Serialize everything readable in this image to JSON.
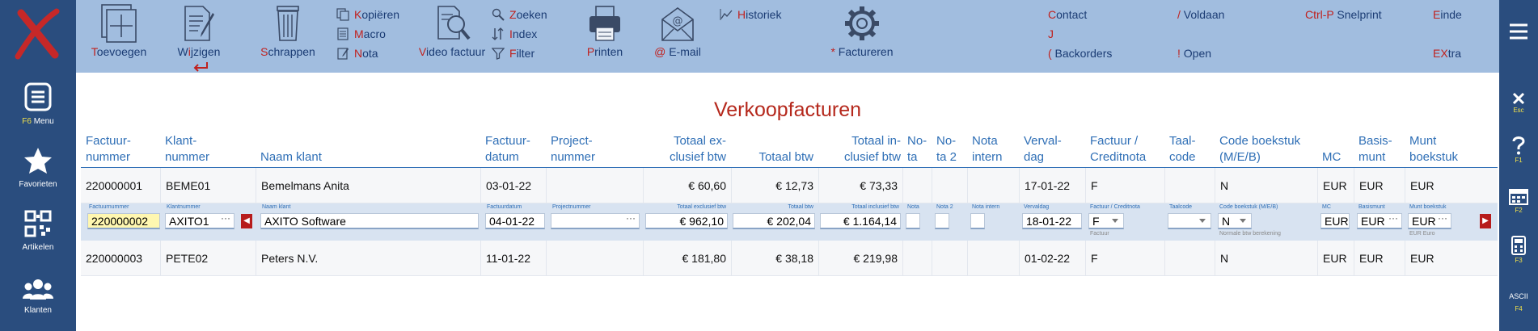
{
  "left_nav": [
    {
      "label": "Menu",
      "key": "F6"
    },
    {
      "label": "Favorieten",
      "key": ""
    },
    {
      "label": "Artikelen",
      "key": ""
    },
    {
      "label": "Klanten",
      "key": ""
    }
  ],
  "right_nav": [
    {
      "label": "",
      "key": "Esc"
    },
    {
      "label": "",
      "key": "F1"
    },
    {
      "label": "",
      "key": "F2"
    },
    {
      "label": "",
      "key": "F3"
    },
    {
      "label": "ASCII",
      "key": "F4"
    }
  ],
  "toolbar": {
    "toevoegen": {
      "hot": "T",
      "rest": "oevoegen"
    },
    "wijzigen": {
      "pre": "W",
      "hot": "i",
      "rest": "jzigen"
    },
    "schrappen": {
      "hot": "S",
      "rest": "chrappen"
    },
    "kopieren": {
      "hot": "K",
      "rest": "opiëren"
    },
    "macro": {
      "hot": "M",
      "rest": "acro"
    },
    "nota": {
      "hot": "N",
      "rest": "ota"
    },
    "video": {
      "hot": "V",
      "rest": "ideo factuur"
    },
    "zoeken": {
      "hot": "Z",
      "rest": "oeken"
    },
    "index": {
      "hot": "I",
      "rest": "ndex"
    },
    "filter": {
      "hot": "F",
      "rest": "ilter"
    },
    "printen": {
      "hot": "P",
      "rest": "rinten"
    },
    "email": {
      "hot": "@",
      "rest": " E-mail"
    },
    "historiek": {
      "hot": "H",
      "rest": "istoriek"
    },
    "factureren": {
      "hot": "*",
      "rest": " Factureren"
    },
    "contact": {
      "hot": "C",
      "rest": "ontact"
    },
    "j_label": {
      "hot": "J",
      "rest": ""
    },
    "backorders": {
      "hot": "(",
      "rest": " Backorders"
    },
    "voldaan": {
      "hot": "/",
      "rest": " Voldaan"
    },
    "open": {
      "hot": "!",
      "rest": " Open"
    },
    "snelprint": {
      "hot": "Ctrl-P",
      "rest": " Snelprint"
    },
    "einde": {
      "hot": "E",
      "rest": "inde"
    },
    "extra": {
      "hot": "EX",
      "rest": "tra"
    }
  },
  "page_title": "Verkoopfacturen",
  "columns": [
    {
      "l1": "Factuur-",
      "l2": "nummer"
    },
    {
      "l1": "Klant-",
      "l2": "nummer"
    },
    {
      "l1": "",
      "l2": "Naam klant"
    },
    {
      "l1": "Factuur-",
      "l2": "datum"
    },
    {
      "l1": "Project-",
      "l2": "nummer"
    },
    {
      "l1": "Totaal ex-",
      "l2": "clusief btw"
    },
    {
      "l1": "",
      "l2": "Totaal btw"
    },
    {
      "l1": "Totaal in-",
      "l2": "clusief btw"
    },
    {
      "l1": "No-",
      "l2": "ta"
    },
    {
      "l1": "No-",
      "l2": "ta 2"
    },
    {
      "l1": "Nota",
      "l2": "intern"
    },
    {
      "l1": "Verval-",
      "l2": "dag"
    },
    {
      "l1": "Factuur /",
      "l2": "Creditnota"
    },
    {
      "l1": "Taal-",
      "l2": "code"
    },
    {
      "l1": "Code boekstuk",
      "l2": "(M/E/B)"
    },
    {
      "l1": "",
      "l2": "MC"
    },
    {
      "l1": "Basis-",
      "l2": "munt"
    },
    {
      "l1": "Munt",
      "l2": "boekstuk"
    }
  ],
  "rows": [
    {
      "factuurnummer": "220000001",
      "klantnummer": "BEME01",
      "naam": "Bemelmans Anita",
      "datum": "03-01-22",
      "project": "",
      "excl": "€ 60,60",
      "btw": "€ 12,73",
      "incl": "€ 73,33",
      "nota": "",
      "nota2": "",
      "nota_intern": "",
      "vervaldag": "17-01-22",
      "fc": "F",
      "taal": "",
      "code": "N",
      "mc": "EUR",
      "basis": "EUR",
      "munt": "EUR"
    },
    {
      "factuurnummer": "220000003",
      "klantnummer": "PETE02",
      "naam": "Peters N.V.",
      "datum": "11-01-22",
      "project": "",
      "excl": "€ 181,80",
      "btw": "€ 38,18",
      "incl": "€ 219,98",
      "nota": "",
      "nota2": "",
      "nota_intern": "",
      "vervaldag": "01-02-22",
      "fc": "F",
      "taal": "",
      "code": "N",
      "mc": "EUR",
      "basis": "EUR",
      "munt": "EUR"
    }
  ],
  "edit_row": {
    "captions": {
      "factuurnummer": "Factuurnummer",
      "klantnummer": "Klantnummer",
      "naam": "Naam klant",
      "datum": "Factuurdatum",
      "project": "Projectnummer",
      "excl": "Totaal exclusief btw",
      "btw": "Totaal btw",
      "incl": "Totaal inclusief btw",
      "nota": "Nota",
      "nota2": "Nota 2",
      "nota_intern": "Nota intern",
      "vervaldag": "Vervaldag",
      "fc": "Factuur / Creditnota",
      "taal": "Taalcode",
      "code": "Code boekstuk (M/E/B)",
      "mc": "MC",
      "basis": "Basismunt",
      "munt": "Munt boekstuk"
    },
    "values": {
      "factuurnummer": "220000002",
      "klantnummer": "AXITO1",
      "naam": "AXITO Software",
      "datum": "04-01-22",
      "project": "",
      "excl": "€ 962,10",
      "btw": "€ 202,04",
      "incl": "€ 1.164,14",
      "vervaldag": "18-01-22",
      "fc": "F",
      "taal": "",
      "code": "N",
      "mc": "EUR",
      "basis": "EUR",
      "munt": "EUR"
    },
    "subs": {
      "fc": "Factuur",
      "code": "Normale btw berekening",
      "munt": "EUR Euro"
    },
    "ellipsis": "···"
  }
}
